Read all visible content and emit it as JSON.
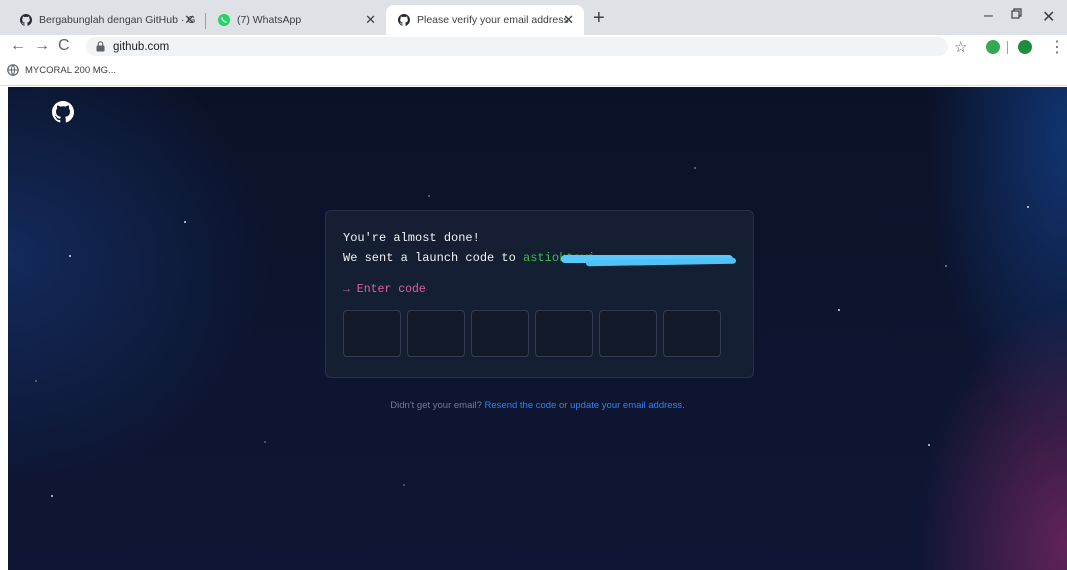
{
  "browser": {
    "tabs": [
      {
        "title": "Bergabunglah dengan GitHub · G",
        "favicon": "github-icon"
      },
      {
        "title": "(7) WhatsApp",
        "favicon": "whatsapp-icon"
      },
      {
        "title": "Please verify your email address",
        "favicon": "github-icon"
      }
    ],
    "url": "github.com",
    "bookmarks": [
      {
        "label": "MYCORAL 200 MG..."
      }
    ]
  },
  "verify": {
    "line1": "You're almost done!",
    "line2_prefix": "We sent a launch code to ",
    "email": "astioktavi",
    "enter_code": "→ Enter code",
    "code_count": 6
  },
  "footer": {
    "text1": "Didn't get your email? ",
    "resend": "Resend the code",
    "text2": " or ",
    "update": "update your email address",
    "text3": "."
  },
  "colors": {
    "accent_link": "#2f81f7",
    "email_green": "#3fb950",
    "prompt_pink": "#db61a2",
    "background": "#0d1530"
  }
}
